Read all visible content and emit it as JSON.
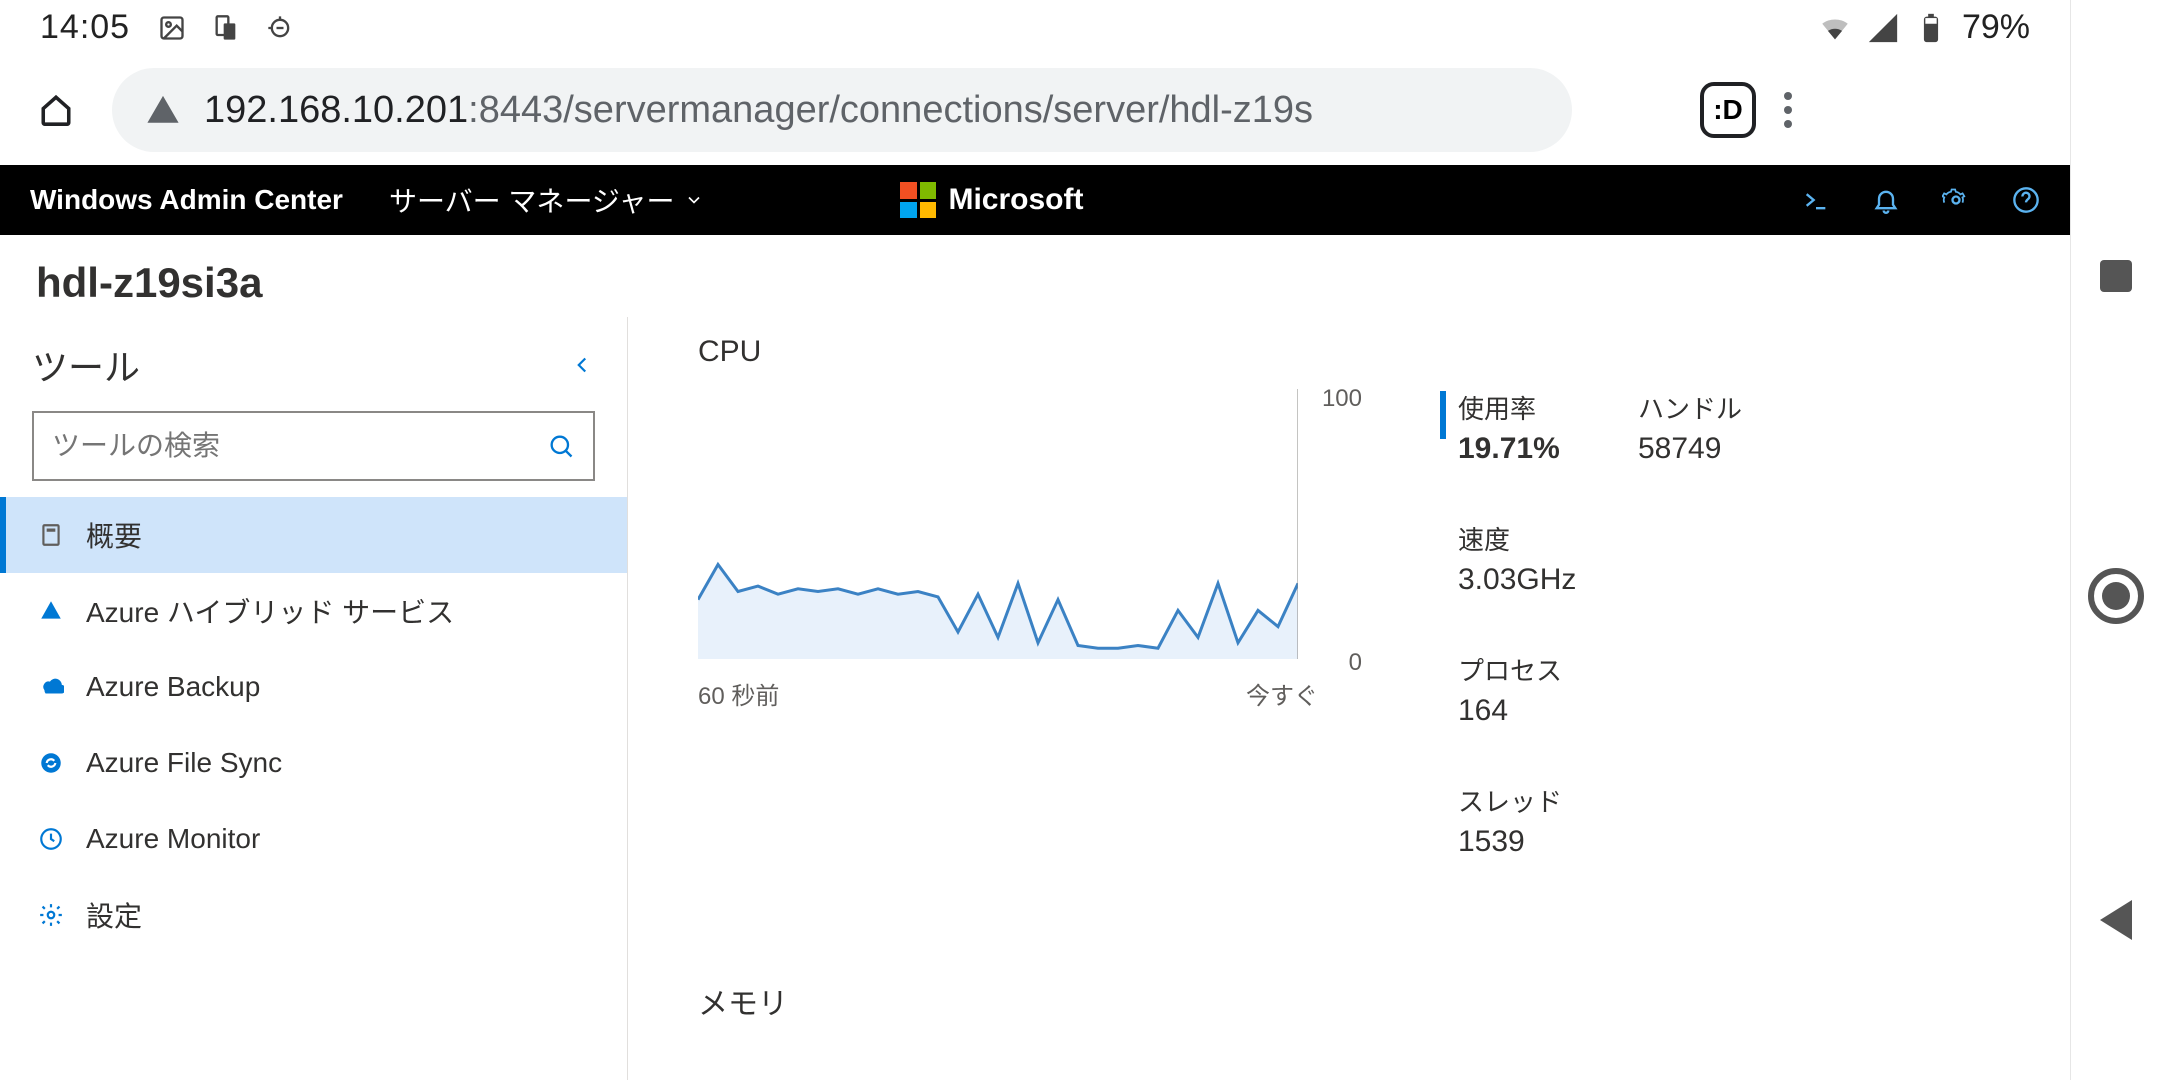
{
  "statusbar": {
    "time": "14:05",
    "battery": "79%"
  },
  "browser": {
    "url_host": "192.168.10.201",
    "url_path": ":8443/servermanager/connections/server/hdl-z19s",
    "tab_label": ":D"
  },
  "ribbon": {
    "product": "Windows Admin Center",
    "context": "サーバー マネージャー",
    "company": "Microsoft"
  },
  "page": {
    "server_name": "hdl-z19si3a"
  },
  "sidebar": {
    "header": "ツール",
    "search_placeholder": "ツールの検索",
    "items": [
      {
        "label": "概要",
        "selected": true
      },
      {
        "label": "Azure ハイブリッド サービス",
        "selected": false
      },
      {
        "label": "Azure Backup",
        "selected": false
      },
      {
        "label": "Azure File Sync",
        "selected": false
      },
      {
        "label": "Azure Monitor",
        "selected": false
      },
      {
        "label": "設定",
        "selected": false
      }
    ]
  },
  "overview": {
    "cpu_title": "CPU",
    "memory_title": "メモリ",
    "axis": {
      "y_top": "100",
      "y_bottom": "0",
      "x_left": "60 秒前",
      "x_right": "今すぐ"
    },
    "stats": {
      "usage_label": "使用率",
      "usage_value": "19.71%",
      "handles_label": "ハンドル",
      "handles_value": "58749",
      "speed_label": "速度",
      "speed_value": "3.03GHz",
      "processes_label": "プロセス",
      "processes_value": "164",
      "threads_label": "スレッド",
      "threads_value": "1539"
    }
  },
  "chart_data": {
    "type": "line",
    "title": "CPU",
    "xlabel": "",
    "ylabel": "",
    "xlim": [
      "60 秒前",
      "今すぐ"
    ],
    "ylim": [
      0,
      100
    ],
    "x": [
      0,
      2,
      4,
      6,
      8,
      10,
      12,
      14,
      16,
      18,
      20,
      22,
      24,
      26,
      28,
      30,
      32,
      34,
      36,
      38,
      40,
      42,
      44,
      46,
      48,
      50,
      52,
      54,
      56,
      58,
      60
    ],
    "series": [
      {
        "name": "CPU使用率",
        "values": [
          22,
          35,
          25,
          27,
          24,
          26,
          25,
          26,
          24,
          26,
          24,
          25,
          23,
          10,
          24,
          8,
          28,
          6,
          22,
          5,
          4,
          4,
          5,
          4,
          18,
          8,
          28,
          6,
          18,
          12,
          28
        ]
      }
    ]
  }
}
